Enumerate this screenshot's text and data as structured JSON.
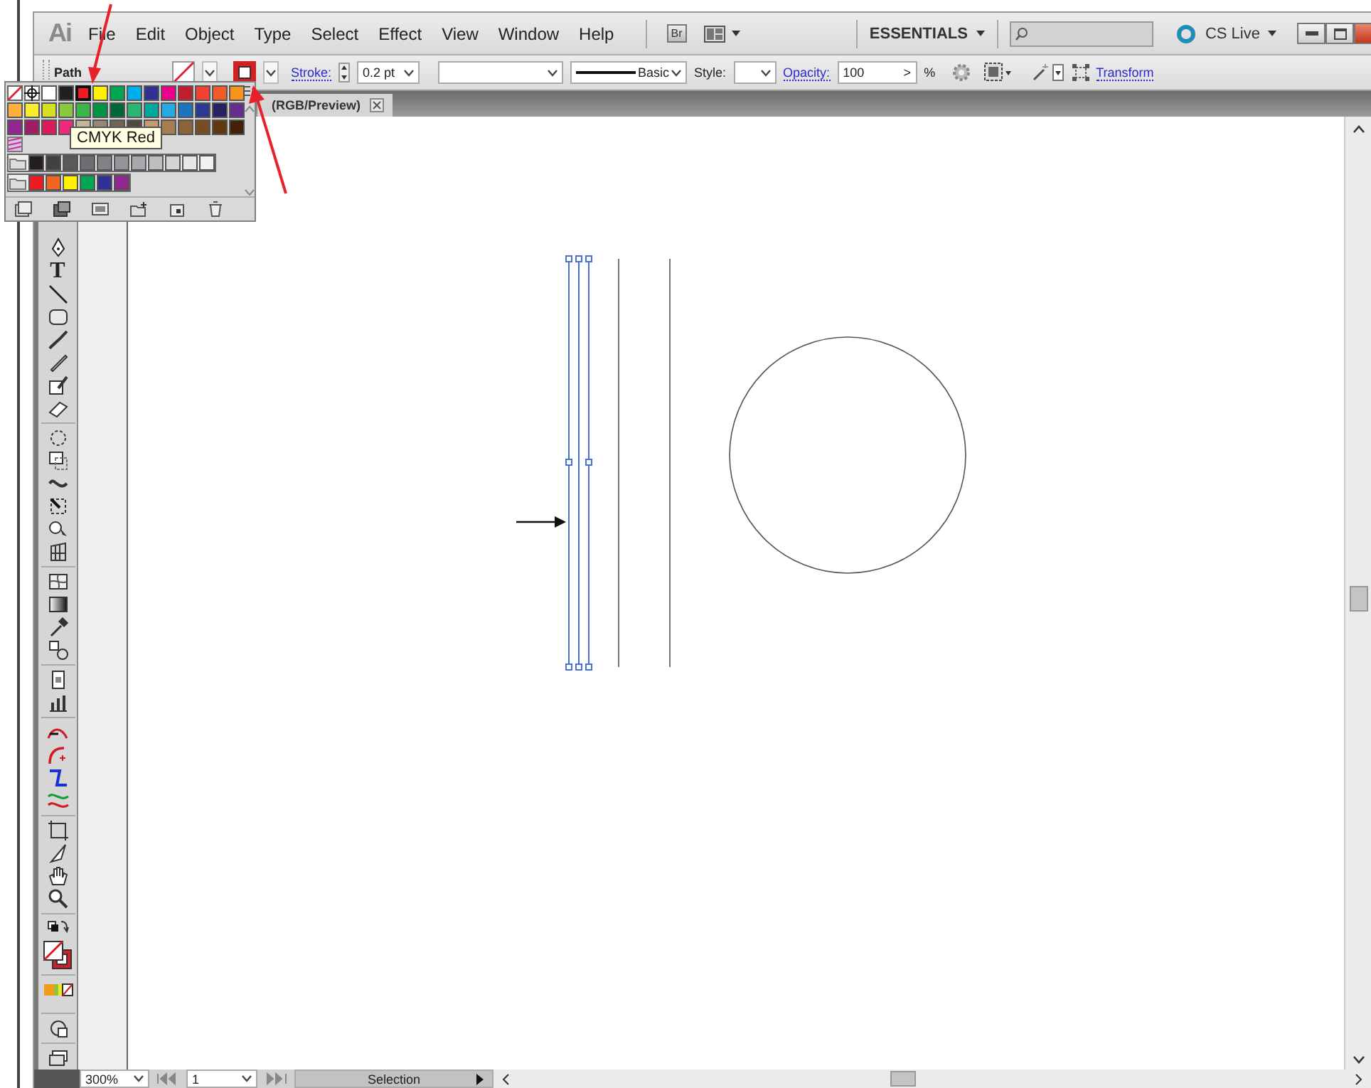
{
  "menu_bar": {
    "logo": "Ai",
    "items": [
      "File",
      "Edit",
      "Object",
      "Type",
      "Select",
      "Effect",
      "View",
      "Window",
      "Help"
    ],
    "bridge_button": "Br",
    "workspace": "ESSENTIALS",
    "cs_live": "CS Live"
  },
  "control_bar": {
    "selection_type": "Path",
    "stroke_label": "Stroke:",
    "stroke_weight": "0.2 pt",
    "brush": "Basic",
    "style_label": "Style:",
    "opacity_label": "Opacity:",
    "opacity": "100",
    "opacity_arrow": ">",
    "percent": "%",
    "transform": "Transform"
  },
  "document_tab": {
    "title": "(RGB/Preview)"
  },
  "swatch_panel": {
    "tooltip": "CMYK Red",
    "rows": [
      [
        {
          "kind": "none",
          "selected": false
        },
        {
          "kind": "registration",
          "selected": false
        },
        {
          "kind": "process",
          "color": "#ffffff",
          "selected": false
        },
        {
          "kind": "process",
          "color": "#231f20",
          "selected": false
        },
        {
          "kind": "process",
          "color": "#ed1c24",
          "selected": true
        },
        {
          "kind": "process",
          "color": "#fff200",
          "selected": false
        },
        {
          "kind": "process",
          "color": "#00a651",
          "selected": false
        },
        {
          "kind": "process",
          "color": "#00aeef",
          "selected": false
        },
        {
          "kind": "process",
          "color": "#2e3192",
          "selected": false
        },
        {
          "kind": "process",
          "color": "#ec008c",
          "selected": false
        },
        {
          "kind": "process",
          "color": "#be1e2d",
          "selected": false
        },
        {
          "kind": "process",
          "color": "#ef4136",
          "selected": false
        },
        {
          "kind": "process",
          "color": "#f15a29",
          "selected": false
        },
        {
          "kind": "process",
          "color": "#f7941d",
          "selected": false
        }
      ],
      [
        {
          "kind": "process",
          "color": "#fbb040",
          "selected": false
        },
        {
          "kind": "process",
          "color": "#f9ed32",
          "selected": false
        },
        {
          "kind": "process",
          "color": "#d7df23",
          "selected": false
        },
        {
          "kind": "process",
          "color": "#8dc63f",
          "selected": false
        },
        {
          "kind": "process",
          "color": "#39b54a",
          "selected": false
        },
        {
          "kind": "process",
          "color": "#009444",
          "selected": false
        },
        {
          "kind": "process",
          "color": "#006838",
          "selected": false
        },
        {
          "kind": "process",
          "color": "#2bb673",
          "selected": false
        },
        {
          "kind": "process",
          "color": "#00a79d",
          "selected": false
        },
        {
          "kind": "process",
          "color": "#27aae1",
          "selected": false
        },
        {
          "kind": "process",
          "color": "#1c75bc",
          "selected": false
        },
        {
          "kind": "process",
          "color": "#2b3990",
          "selected": false
        },
        {
          "kind": "process",
          "color": "#262262",
          "selected": false
        },
        {
          "kind": "process",
          "color": "#662d91",
          "selected": false
        }
      ],
      [
        {
          "kind": "process",
          "color": "#92278f",
          "selected": false
        },
        {
          "kind": "process",
          "color": "#9e1f63",
          "selected": false
        },
        {
          "kind": "process",
          "color": "#da1c5c",
          "selected": false
        },
        {
          "kind": "process",
          "color": "#ee2a7b",
          "selected": false
        },
        {
          "kind": "process",
          "color": "#c2b59b",
          "selected": false
        },
        {
          "kind": "process",
          "color": "#998675",
          "selected": false
        },
        {
          "kind": "process",
          "color": "#736357",
          "selected": false
        },
        {
          "kind": "process",
          "color": "#534741",
          "selected": false
        },
        {
          "kind": "process",
          "color": "#c69c6d",
          "selected": false
        },
        {
          "kind": "process",
          "color": "#a67c52",
          "selected": false
        },
        {
          "kind": "process",
          "color": "#8c6239",
          "selected": false
        },
        {
          "kind": "process",
          "color": "#754c24",
          "selected": false
        },
        {
          "kind": "process",
          "color": "#603913",
          "selected": false
        },
        {
          "kind": "process",
          "color": "#42210b",
          "selected": false
        }
      ],
      [
        {
          "kind": "pattern",
          "selected": false
        }
      ],
      [
        {
          "kind": "folder",
          "selected": false
        },
        {
          "kind": "process",
          "color": "#231f20",
          "selected": false
        },
        {
          "kind": "process",
          "color": "#414042",
          "selected": false
        },
        {
          "kind": "process",
          "color": "#58595b",
          "selected": false
        },
        {
          "kind": "process",
          "color": "#6d6e71",
          "selected": false
        },
        {
          "kind": "process",
          "color": "#808285",
          "selected": false
        },
        {
          "kind": "process",
          "color": "#939598",
          "selected": false
        },
        {
          "kind": "process",
          "color": "#a7a9ac",
          "selected": false
        },
        {
          "kind": "process",
          "color": "#bcbec0",
          "selected": false
        },
        {
          "kind": "process",
          "color": "#d1d3d4",
          "selected": false
        },
        {
          "kind": "process",
          "color": "#e6e7e8",
          "selected": false
        },
        {
          "kind": "process",
          "color": "#f1f2f2",
          "selected": false
        }
      ],
      [
        {
          "kind": "folder",
          "selected": false
        },
        {
          "kind": "process",
          "color": "#ed1c24",
          "selected": false
        },
        {
          "kind": "process",
          "color": "#f26522",
          "selected": false
        },
        {
          "kind": "process",
          "color": "#fff200",
          "selected": false
        },
        {
          "kind": "process",
          "color": "#00a651",
          "selected": false
        },
        {
          "kind": "process",
          "color": "#2e3192",
          "selected": false
        },
        {
          "kind": "process",
          "color": "#92278f",
          "selected": false
        }
      ]
    ]
  },
  "tools_panel": {
    "type_tool": "T"
  },
  "status_bar": {
    "zoom": "300%",
    "artboard": "1",
    "tool": "Selection"
  }
}
